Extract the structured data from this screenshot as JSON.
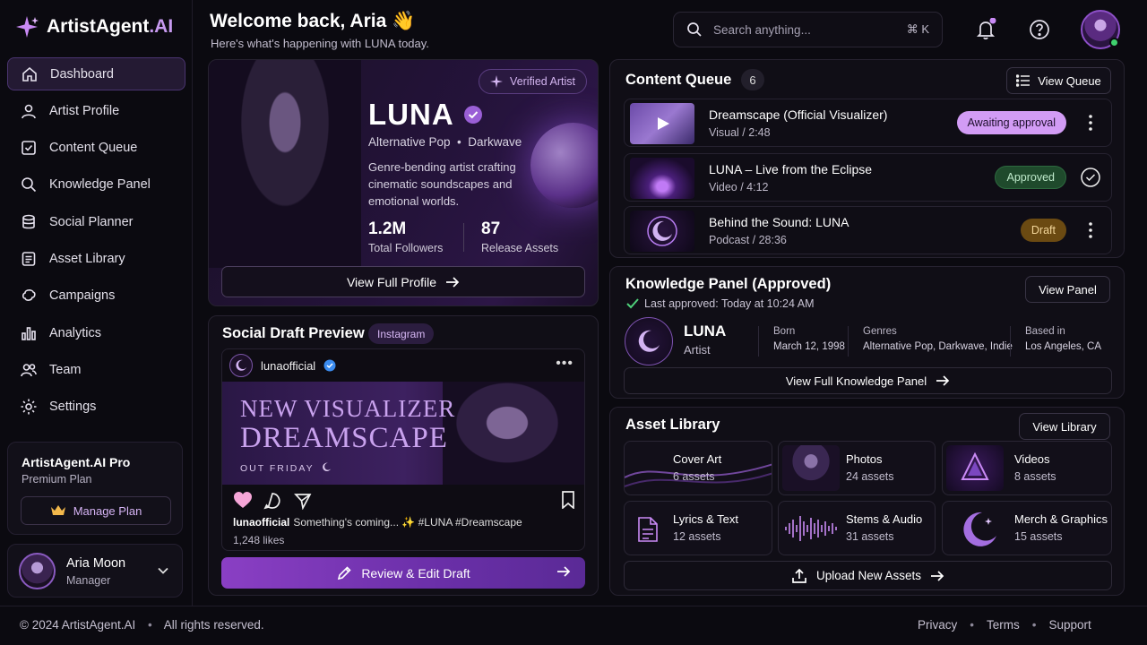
{
  "app": {
    "name_main": "ArtistAgent",
    "name_accent": ".AI"
  },
  "sidebar": {
    "items": [
      {
        "label": "Dashboard",
        "icon": "home-icon",
        "active": true
      },
      {
        "label": "Artist Profile",
        "icon": "user-icon"
      },
      {
        "label": "Content Queue",
        "icon": "checkbox-icon"
      },
      {
        "label": "Knowledge Panel",
        "icon": "search-icon"
      },
      {
        "label": "Social Planner",
        "icon": "database-icon"
      },
      {
        "label": "Asset Library",
        "icon": "document-icon"
      },
      {
        "label": "Campaigns",
        "icon": "megaphone-icon"
      },
      {
        "label": "Analytics",
        "icon": "bar-chart-icon"
      },
      {
        "label": "Team",
        "icon": "team-icon"
      },
      {
        "label": "Settings",
        "icon": "gear-icon"
      }
    ],
    "plan": {
      "title": "ArtistAgent.AI Pro",
      "subtitle": "Premium Plan",
      "button": "Manage Plan"
    },
    "user": {
      "name": "Aria Moon",
      "role": "Manager"
    }
  },
  "header": {
    "title": "Welcome back, Aria 👋",
    "subtitle": "Here's what's happening with LUNA today.",
    "search_placeholder": "Search anything...",
    "shortcut": "⌘ K"
  },
  "artist": {
    "badge": "Verified Artist",
    "name": "LUNA",
    "genres": "Alternative Pop  •  Darkwave",
    "bio": "Genre-bending artist crafting cinematic soundscapes and emotional worlds.",
    "stats": [
      {
        "value": "1.2M",
        "label": "Total Followers"
      },
      {
        "value": "87",
        "label": "Release Assets"
      }
    ],
    "button": "View Full Profile"
  },
  "social": {
    "title": "Social Draft Preview",
    "platform": "Instagram",
    "handle": "lunaofficial",
    "headline_1": "NEW VISUALIZER",
    "headline_2": "DREAMSCAPE",
    "out": "OUT FRIDAY",
    "caption_user": "lunaofficial",
    "caption": "Something's coming... ✨ #LUNA #Dreamscape",
    "likes": "1,248 likes",
    "button": "Review & Edit Draft"
  },
  "queue": {
    "title": "Content Queue",
    "count": "6",
    "button": "View Queue",
    "items": [
      {
        "title": "Dreamscape (Official Visualizer)",
        "meta": "Visual / 2:48",
        "status": "Awaiting approval"
      },
      {
        "title": "LUNA – Live from the Eclipse",
        "meta": "Video / 4:12",
        "status": "Approved"
      },
      {
        "title": "Behind the Sound: LUNA",
        "meta": "Podcast / 28:36",
        "status": "Draft"
      }
    ]
  },
  "knowledge": {
    "title": "Knowledge Panel (Approved)",
    "button": "View Panel",
    "updated": "Last approved: Today at 10:24 AM",
    "name": "LUNA",
    "type": "Artist",
    "fields": [
      {
        "label": "Born",
        "value": "March 12, 1998"
      },
      {
        "label": "Genres",
        "value": "Alternative Pop, Darkwave, Indie"
      },
      {
        "label": "Based in",
        "value": "Los Angeles, CA"
      }
    ],
    "full_button": "View Full Knowledge Panel"
  },
  "assets": {
    "title": "Asset Library",
    "button": "View Library",
    "tiles": [
      {
        "name": "Cover Art",
        "count": "6 assets"
      },
      {
        "name": "Photos",
        "count": "24 assets"
      },
      {
        "name": "Videos",
        "count": "8 assets"
      },
      {
        "name": "Lyrics & Text",
        "count": "12 assets"
      },
      {
        "name": "Stems & Audio",
        "count": "31 assets"
      },
      {
        "name": "Merch & Graphics",
        "count": "15 assets"
      }
    ],
    "upload": "Upload New Assets"
  },
  "footer": {
    "copyright": "© 2024 ArtistAgent.AI",
    "rights": "All rights reserved.",
    "links": [
      "Privacy",
      "Terms",
      "Support"
    ]
  },
  "colors": {
    "accent": "#b67cf0",
    "approved": "#1f4a2c",
    "awaiting": "#d29cf5",
    "draft": "#6b4a12"
  }
}
